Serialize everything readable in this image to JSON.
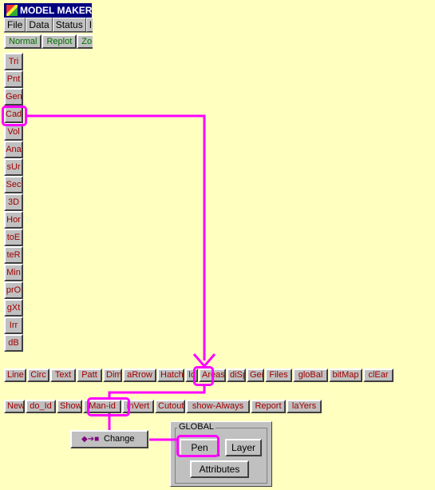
{
  "app": {
    "title": "MODEL MAKER"
  },
  "menubar": [
    "File",
    "Data",
    "Status",
    "I"
  ],
  "viewbar": [
    "Normal",
    "Replot",
    "Zo"
  ],
  "vertical_toolbar": [
    "Tri",
    "Pnt",
    "Gen",
    "Cad",
    "Vol",
    "Ana",
    "sUr",
    "Sec",
    "3D",
    "Hor",
    "toE",
    "teR",
    "Min",
    "prO",
    "gXt",
    "Irr",
    "dB"
  ],
  "cad_toolbar": [
    "Line",
    "Circ",
    "Text",
    "Patt",
    "Dim",
    "aRrow",
    "Hatch",
    "Id",
    "Areas",
    "diSp",
    "Gen",
    "Files",
    "gloBal",
    "bitMap",
    "clEar"
  ],
  "id_toolbar": [
    "New",
    "do_Id",
    "Show",
    "Man-id",
    "inVert",
    "Cutout",
    "show-Always",
    "Report",
    "laYers"
  ],
  "change_button": {
    "label": "Change",
    "icon": "pen-change-icon"
  },
  "global_panel": {
    "group_label": "GLOBAL",
    "pen_label": "Pen",
    "layer_label": "Layer",
    "attributes_label": "Attributes"
  },
  "colors": {
    "background": "#ffffc0",
    "highlight": "#ff00ff",
    "button_face": "#c0c0c0",
    "button_text": "#a00000"
  }
}
